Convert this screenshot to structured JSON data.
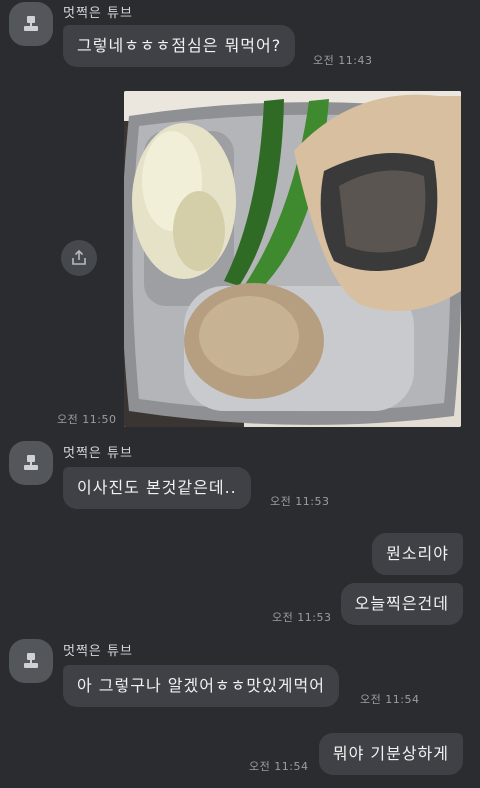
{
  "chat": {
    "sender_name": "멋쩍은 튜브",
    "messages": [
      {
        "text": "그렇네ㅎㅎㅎ점심은 뭐먹어?",
        "time": "오전 11:43"
      },
      {
        "time": "오전 11:50"
      },
      {
        "text": "이사진도 본것같은데..",
        "time": "오전 11:53"
      },
      {
        "text": "뭔소리야"
      },
      {
        "text": "오늘찍은건데",
        "time": "오전 11:53"
      },
      {
        "text": "아 그렇구나 알겠어ㅎㅎ맛있게먹어",
        "time": "오전 11:54"
      },
      {
        "text": "뭐야 기분상하게",
        "time": "오전 11:54"
      }
    ]
  },
  "icons": {
    "avatar": "person-icon",
    "share": "share-icon"
  },
  "colors": {
    "background": "#2b2c2f",
    "bubble": "#3f4146",
    "avatar": "#53565b"
  }
}
